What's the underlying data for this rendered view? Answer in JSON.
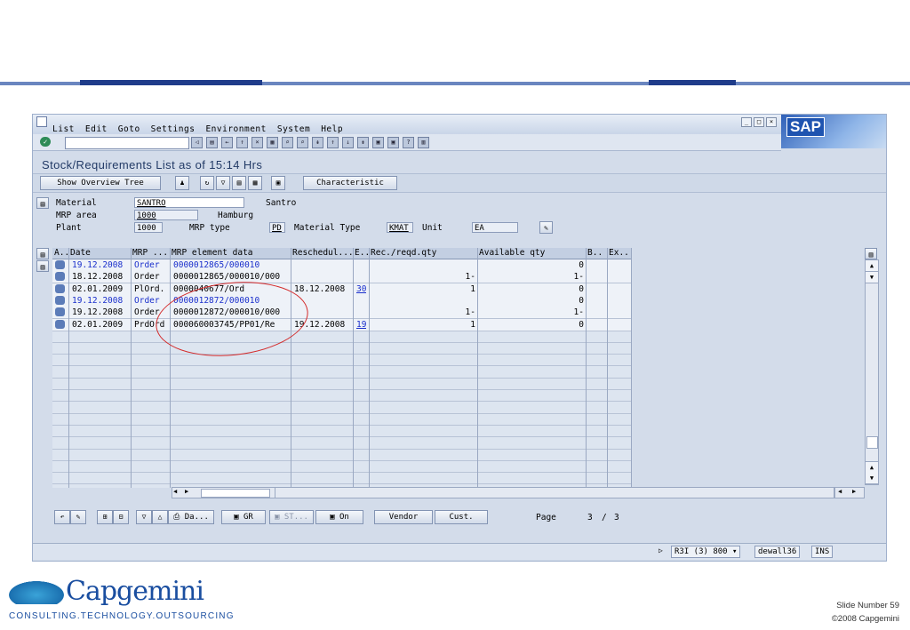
{
  "slide": {
    "slide_label": "Slide Number 59",
    "copyright": "©2008 Capgemini",
    "logo_word": "Capgemini",
    "logo_tagline": "CONSULTING.TECHNOLOGY.OUTSOURCING",
    "accent_color": "#1f3c8a"
  },
  "sap": {
    "menu": [
      "List",
      "Edit",
      "Goto",
      "Settings",
      "Environment",
      "System",
      "Help"
    ],
    "logo_text": "SAP",
    "title": "Stock/Requirements List as of 15:14 Hrs",
    "toolbar": {
      "show_overview_tree": "Show Overview Tree",
      "characteristic": "Characteristic"
    },
    "header": {
      "material_label": "Material",
      "material_value": "SANTRO",
      "material_desc": "Santro",
      "mrp_area_label": "MRP area",
      "mrp_area_value": "1000",
      "mrp_area_desc": "Hamburg",
      "plant_label": "Plant",
      "plant_value": "1000",
      "mrp_type_label": "MRP type",
      "mrp_type_value": "PD",
      "material_type_label": "Material Type",
      "material_type_value": "KMAT",
      "unit_label": "Unit",
      "unit_value": "EA"
    },
    "grid": {
      "columns": [
        "A..",
        "Date",
        "MRP ...",
        "MRP element data",
        "Reschedul...",
        "E..",
        "Rec./reqd.qty",
        "Available qty",
        "B..",
        "Ex.."
      ],
      "rows": [
        {
          "date": "19.12.2008",
          "element": "Order",
          "data": "0000012865/000010",
          "resched": "",
          "e": "",
          "qty": "",
          "avail": "0",
          "blue": true
        },
        {
          "date": "18.12.2008",
          "element": "Order",
          "data": "0000012865/000010/000",
          "resched": "",
          "e": "",
          "qty": "1-",
          "avail": "1-",
          "blue": false
        },
        {
          "date": "02.01.2009",
          "element": "PlOrd.",
          "data": "0000040677/Ord",
          "resched": "18.12.2008",
          "e": "30",
          "qty": "1",
          "avail": "0",
          "blue": false
        },
        {
          "date": "19.12.2008",
          "element": "Order",
          "data": "0000012872/000010",
          "resched": "",
          "e": "",
          "qty": "",
          "avail": "0",
          "blue": true
        },
        {
          "date": "19.12.2008",
          "element": "Order",
          "data": "0000012872/000010/000",
          "resched": "",
          "e": "",
          "qty": "1-",
          "avail": "1-",
          "blue": false
        },
        {
          "date": "02.01.2009",
          "element": "PrdOrd",
          "data": "000060003745/PP01/Re",
          "resched": "19.12.2008",
          "e": "19",
          "qty": "1",
          "avail": "0",
          "blue": false
        }
      ]
    },
    "bottom": {
      "da_label": "Da...",
      "gr_label": "GR",
      "st_label": "ST...",
      "on_label": "On",
      "vendor_label": "Vendor",
      "cust_label": "Cust.",
      "page_label": "Page",
      "page_current": "3",
      "page_sep": "/",
      "page_total": "3"
    },
    "status": {
      "system": "R3I (3) 800",
      "user": "dewall36",
      "mode": "INS"
    }
  }
}
